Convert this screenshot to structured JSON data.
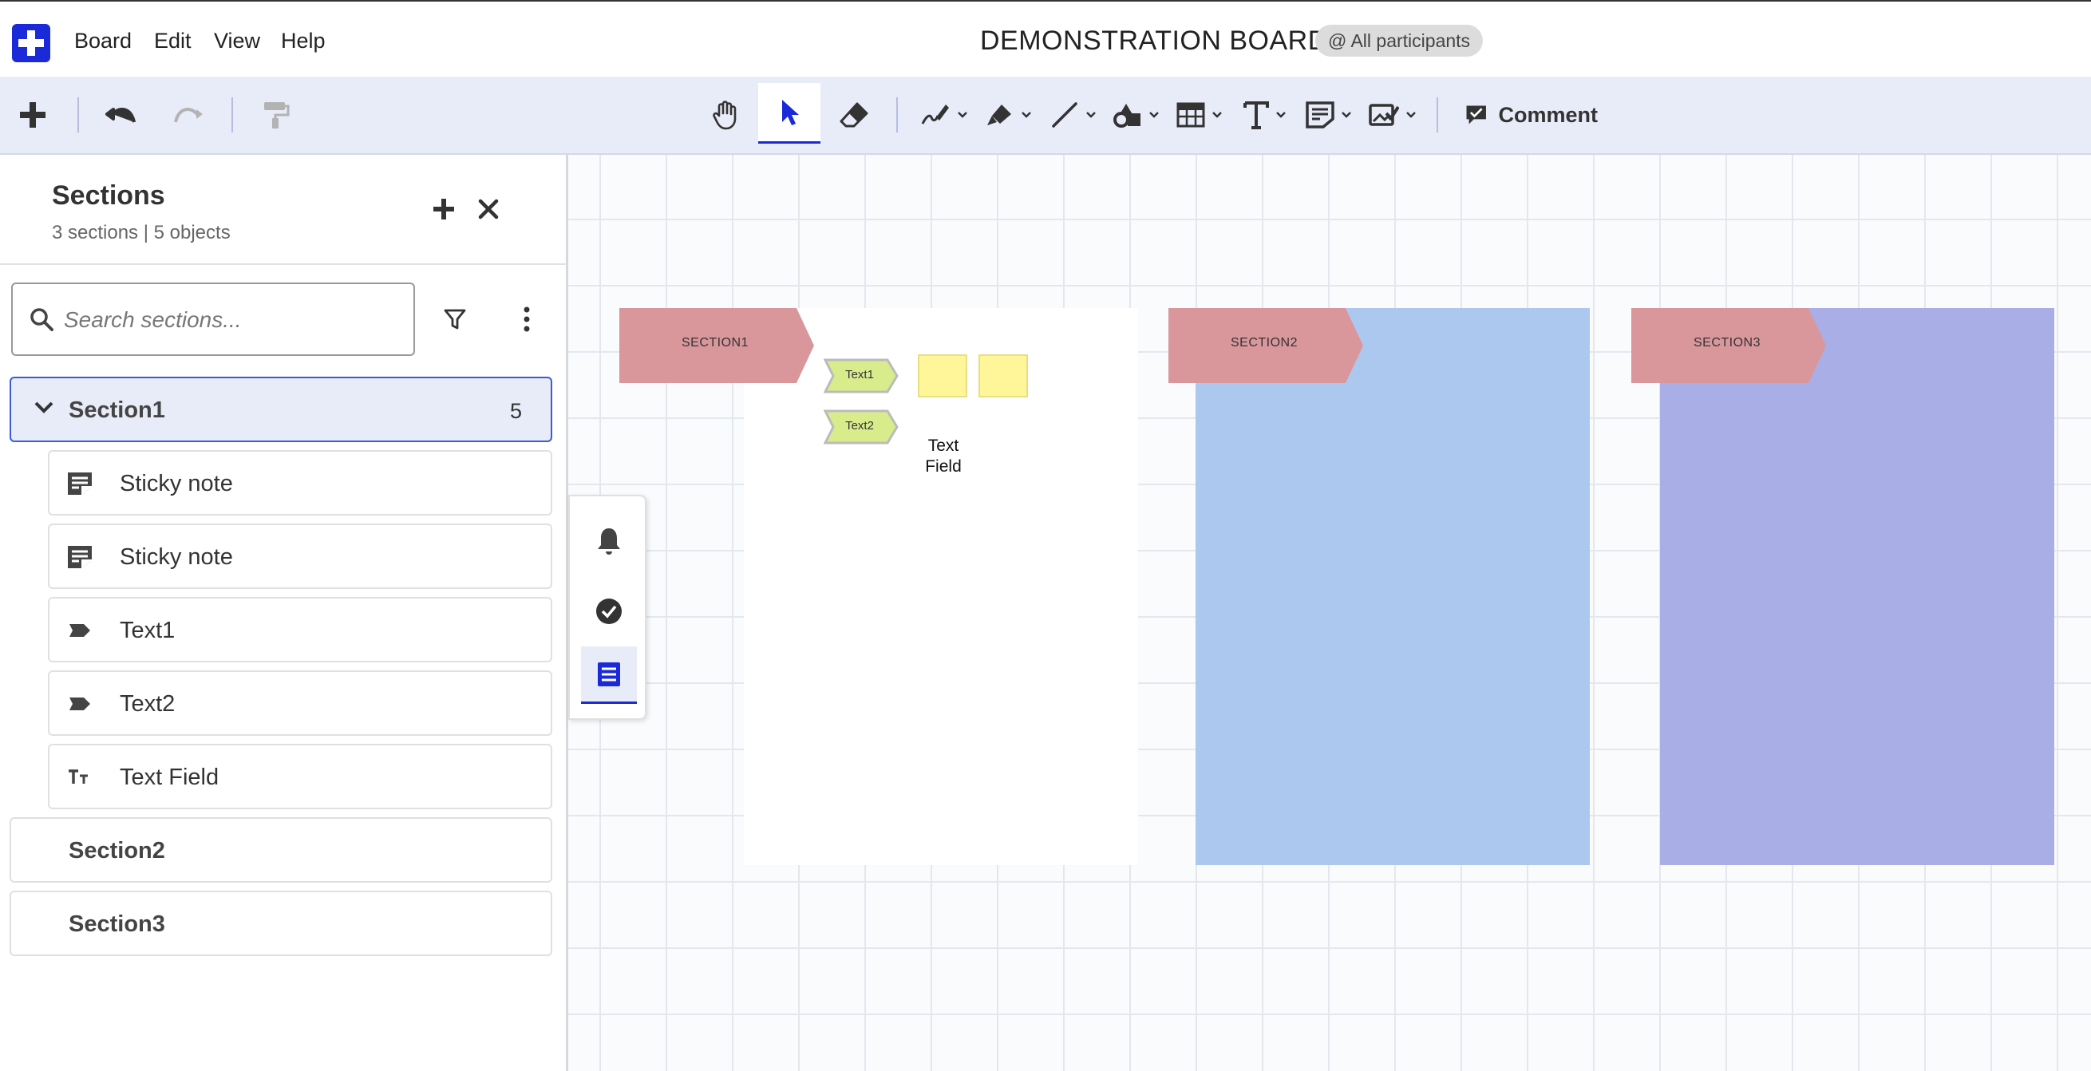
{
  "app": {
    "logo_icon": "plus-logo-icon",
    "accent_color": "#1a2ad8"
  },
  "menu": {
    "items": [
      "Board",
      "Edit",
      "View",
      "Help"
    ]
  },
  "header": {
    "board_title": "DEMONSTRATION BOARD",
    "participants_label": "@ All participants"
  },
  "toolbar": {
    "comment_label": "Comment",
    "tools": [
      "add-icon",
      "undo-icon",
      "redo-icon",
      "format-painter-icon",
      "hand-icon",
      "pointer-icon",
      "eraser-icon",
      "pen-icon",
      "highlighter-icon",
      "line-icon",
      "shapes-icon",
      "table-icon",
      "text-icon",
      "sticky-note-icon",
      "image-icon",
      "comment-icon"
    ],
    "active_tool": "pointer-icon"
  },
  "sidebar": {
    "title": "Sections",
    "subtitle": "3 sections | 5 objects",
    "search_placeholder": "Search sections...",
    "sections": [
      {
        "label": "Section1",
        "count": "5",
        "expanded": true,
        "objects": [
          {
            "label": "Sticky note",
            "icon": "sticky-note-icon"
          },
          {
            "label": "Sticky note",
            "icon": "sticky-note-icon"
          },
          {
            "label": "Text1",
            "icon": "tag-icon"
          },
          {
            "label": "Text2",
            "icon": "tag-icon"
          },
          {
            "label": "Text Field",
            "icon": "text-field-icon"
          }
        ]
      },
      {
        "label": "Section2",
        "count": ""
      },
      {
        "label": "Section3",
        "count": ""
      }
    ]
  },
  "canvas": {
    "sections": [
      {
        "tag": "SECTION1",
        "fill": "#ffffff",
        "tag_color": "#d9979c"
      },
      {
        "tag": "SECTION2",
        "fill": "#adc8ef",
        "tag_color": "#d9979c"
      },
      {
        "tag": "SECTION3",
        "fill": "#a9aee7",
        "tag_color": "#d9979c"
      }
    ],
    "chips": [
      "Text1",
      "Text2"
    ],
    "chip_color": "#d9ec8c",
    "sticky_color": "#fff69a",
    "text_field": "Text Field"
  },
  "float_panel": {
    "icons": [
      "bell-icon",
      "check-circle-icon",
      "sections-list-icon"
    ],
    "active": "sections-list-icon"
  }
}
